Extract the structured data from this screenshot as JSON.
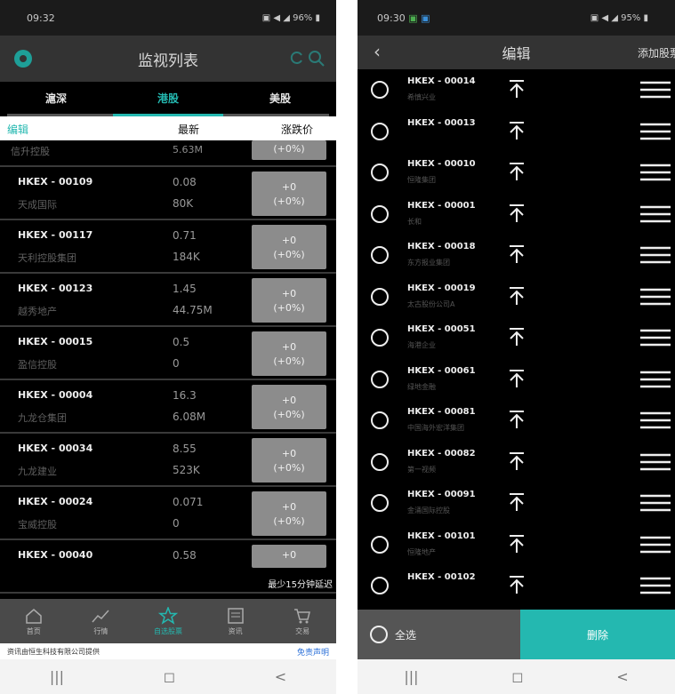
{
  "left": {
    "status": {
      "time": "09:32",
      "battery": "96%"
    },
    "title": "监视列表",
    "market_tabs": [
      "滬深",
      "港股",
      "美股"
    ],
    "active_tab": 1,
    "columns": {
      "edit": "编辑",
      "latest": "最新",
      "change": "涨跌价"
    },
    "partial_row": {
      "name": "信升控股",
      "vol": "5.63M",
      "change": "(+0%)"
    },
    "rows": [
      {
        "code": "HKEX - 00109",
        "name": "天成国际",
        "price": "0.08",
        "vol": "80K",
        "change": "+0",
        "pct": "(+0%)"
      },
      {
        "code": "HKEX - 00117",
        "name": "天利控股集团",
        "price": "0.71",
        "vol": "184K",
        "change": "+0",
        "pct": "(+0%)"
      },
      {
        "code": "HKEX - 00123",
        "name": "越秀地产",
        "price": "1.45",
        "vol": "44.75M",
        "change": "+0",
        "pct": "(+0%)"
      },
      {
        "code": "HKEX - 00015",
        "name": "盈信控股",
        "price": "0.5",
        "vol": "0",
        "change": "+0",
        "pct": "(+0%)"
      },
      {
        "code": "HKEX - 00004",
        "name": "九龙仓集团",
        "price": "16.3",
        "vol": "6.08M",
        "change": "+0",
        "pct": "(+0%)"
      },
      {
        "code": "HKEX - 00034",
        "name": "九龙建业",
        "price": "8.55",
        "vol": "523K",
        "change": "+0",
        "pct": "(+0%)"
      },
      {
        "code": "HKEX - 00024",
        "name": "宝威控股",
        "price": "0.071",
        "vol": "0",
        "change": "+0",
        "pct": "(+0%)"
      },
      {
        "code": "HKEX - 00040",
        "name": "",
        "price": "0.58",
        "vol": "",
        "change": "+0",
        "pct": ""
      }
    ],
    "delay_note": "最少15分钟延迟",
    "nav": [
      "首页",
      "行情",
      "自选股票",
      "资讯",
      "交易"
    ],
    "active_nav": 2,
    "footer_left": "资讯由恒生科技有限公司提供",
    "footer_right": "免责声明"
  },
  "right": {
    "status": {
      "time": "09:30",
      "battery": "95%"
    },
    "title": "编辑",
    "add_label": "添加股票",
    "rows": [
      {
        "code": "HKEX - 00014",
        "name": "希慎兴业"
      },
      {
        "code": "HKEX - 00013",
        "name": ""
      },
      {
        "code": "HKEX - 00010",
        "name": "恒隆集团"
      },
      {
        "code": "HKEX - 00001",
        "name": "长和"
      },
      {
        "code": "HKEX - 00018",
        "name": "东方报业集团"
      },
      {
        "code": "HKEX - 00019",
        "name": "太古股份公司A"
      },
      {
        "code": "HKEX - 00051",
        "name": "海港企业"
      },
      {
        "code": "HKEX - 00061",
        "name": "绿地金融"
      },
      {
        "code": "HKEX - 00081",
        "name": "中国海外宏洋集团"
      },
      {
        "code": "HKEX - 00082",
        "name": "第一视频"
      },
      {
        "code": "HKEX - 00091",
        "name": "金涌国际控股"
      },
      {
        "code": "HKEX - 00101",
        "name": "恒隆地产"
      },
      {
        "code": "HKEX - 00102",
        "name": ""
      }
    ],
    "select_all": "全选",
    "delete": "删除"
  },
  "sysnav": [
    "|||",
    "◻",
    "<"
  ],
  "colors": {
    "accent": "#24b8b0",
    "badge": "#8c8c8c"
  }
}
